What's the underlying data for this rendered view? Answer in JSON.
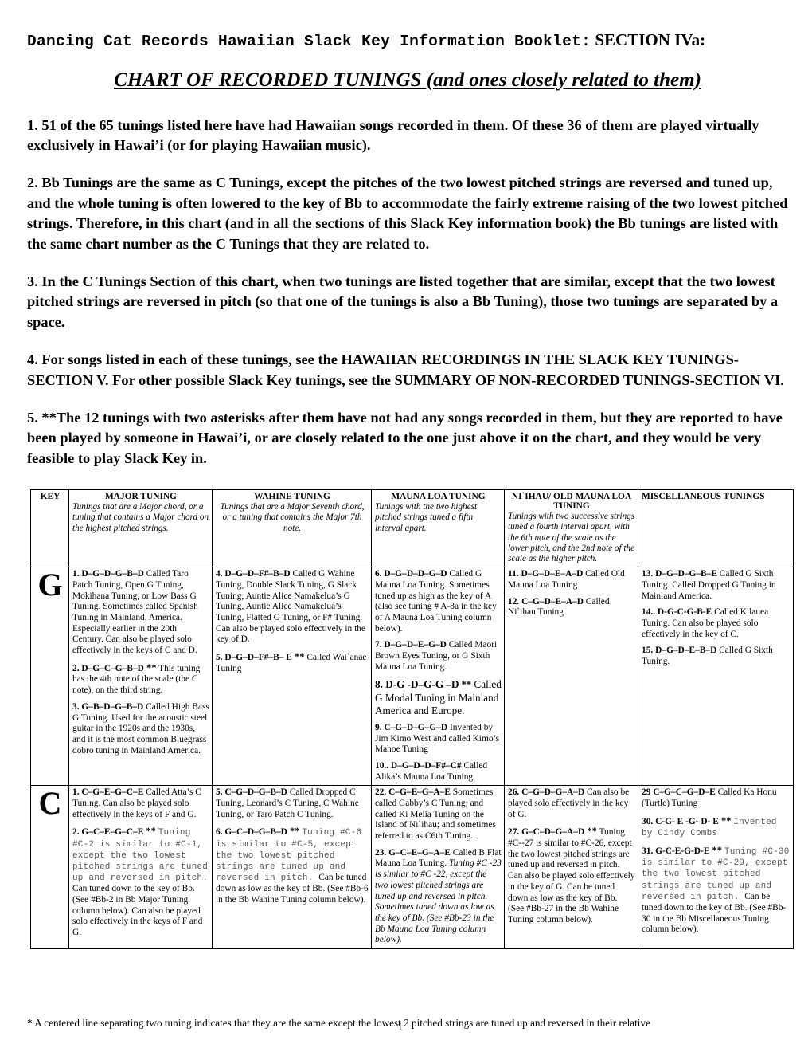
{
  "header": {
    "booklet_title_mono": "Dancing Cat Records Hawaiian Slack Key Information Booklet:",
    "booklet_title_serif": " SECTION IVa:",
    "chart_title_underlined": "CHART OF RECORDED TUNINGS",
    "chart_title_paren": " (and ones closely related to them)"
  },
  "notes": [
    {
      "id": "note-1",
      "text": "1. 51 of the 65 tunings listed here have had Hawaiian songs recorded in them. Of these 36 of them are played virtually exclusively in Hawai’i (or for playing Hawaiian music)."
    },
    {
      "id": "note-2",
      "text": "2. Bb Tunings are the same as C Tunings, except the pitches of the two lowest pitched strings are reversed and tuned up, and the whole tuning is often lowered to the key of Bb to accommodate the fairly extreme raising of the two lowest pitched strings. Therefore, in this chart (and in all the sections of this Slack Key information book) the Bb tunings are listed with the same chart number as the C Tunings that they are related to."
    },
    {
      "id": "note-3",
      "text": "3. In the C Tunings Section of this chart, when two tunings are listed together that are similar, except that the two lowest pitched strings are reversed in pitch (so that one of the tunings is also a Bb Tuning), those two tunings are separated by a space."
    },
    {
      "id": "note-4",
      "text": "4. For songs listed in each of these tunings, see the HAWAIIAN RECORDINGS IN THE SLACK KEY TUNINGS-SECTION V.  For other possible Slack Key tunings, see the SUMMARY OF NON-RECORDED TUNINGS-SECTION VI."
    },
    {
      "id": "note-5",
      "text": "5. **The 12 tunings with two asterisks after them have not had any songs recorded in them, but they are reported to have been played by someone in Hawai’i, or are closely related to the one just above  it on the chart, and they would be very feasible to play Slack Key in."
    }
  ],
  "table": {
    "headers": [
      {
        "title": "KEY",
        "desc": ""
      },
      {
        "title": "MAJOR TUNING",
        "desc": "Tunings that are a Major chord, or a tuning that contains a Major chord on the highest pitched strings."
      },
      {
        "title": "WAHINE TUNING",
        "desc": "Tunings that are a Major Seventh chord, or a tuning that contains the Major 7th note."
      },
      {
        "title": "MAUNA LOA TUNING",
        "desc": "Tunings with the two highest pitched strings tuned a fifth interval apart."
      },
      {
        "title": "NI`IHAU/ OLD MAUNA LOA TUNING",
        "desc": "Tunings with two successive strings tuned a fourth interval apart, with the 6th note of the scale as the lower pitch, and the 2nd note of the scale as the higher pitch."
      },
      {
        "title": "MISCELLANEOUS TUNINGS",
        "desc": ""
      }
    ],
    "rows": [
      {
        "key": "G",
        "major": [
          {
            "num": "1. D–G–D–G–B–D",
            "asterisks": "",
            "body": "Called Taro Patch Tuning, Open G Tuning, Mokihana Tuning, or Low Bass G Tuning. Sometimes called Spanish Tuning in Mainland. America. Especially earlier in the 20th Century. Can also be played solo effectively in the keys of C and D."
          },
          {
            "num": "2.  D–G–C–G–B–D",
            "asterisks": "**",
            "body": "This tuning has the 4th note of the scale (the C note), on the third string."
          },
          {
            "num": "3.  G–B–D–G–B–D",
            "asterisks": "",
            "body": "Called High Bass G Tuning. Used for the acoustic steel guitar in the 1920s and the 1930s, and it is the most common Bluegrass dobro tuning in Mainland America."
          }
        ],
        "wahine": [
          {
            "num": "4. D–G–D–F#–B–D",
            "asterisks": "",
            "body": "Called G Wahine Tuning, Double Slack Tuning, G Slack Tuning, Auntie Alice Namakelua’s G Tuning, Auntie Alice Namakelua’s Tuning, Flatted G Tuning, or F# Tuning. Can also be played solo effectively in the key of  D."
          },
          {
            "num": "5. D–G–D–F#–B– E",
            "asterisks": "**",
            "body": "Called Wai`anae Tuning"
          }
        ],
        "mauna": [
          {
            "num": "6. D–G–D–D–G–D",
            "asterisks": "",
            "body": "Called G Mauna Loa Tuning. Sometimes tuned up as high as the key of A (also see tuning # A-8a  in the key of A Mauna Loa Tuning column below)."
          },
          {
            "num": "7. D–G–D–E–G–D",
            "asterisks": "",
            "body": "Called Maori Brown Eyes Tuning, or G Sixth Mauna Loa Tuning."
          },
          {
            "num": "8. D-G -D–G-G –D",
            "asterisks": "**",
            "body": "Called G Modal Tuning in Mainland America and Europe."
          },
          {
            "num": "9. C–G–D–G–G–D",
            "asterisks": "",
            "body": "Invented by Jim Kimo West and called Kimo’s Mahoe Tuning"
          },
          {
            "num": "10.. D–G–D–D–F#–C#",
            "asterisks": "",
            "body": "Called Alika’s Mauna Loa Tuning"
          }
        ],
        "niihau": [
          {
            "num": "11.  D–G–D–E–A–D",
            "asterisks": "",
            "body": "Called Old Mauna Loa Tuning"
          },
          {
            "num": "12. C–G–D–E–A–D",
            "asterisks": "",
            "body": "Called Ni`ihau Tuning"
          }
        ],
        "misc": [
          {
            "num": "13.  D–G–D–G–B–E",
            "asterisks": "",
            "body": "Called G Sixth Tuning. Called Dropped G Tuning in Mainland America."
          },
          {
            "num": "14.. D-G-C-G-B-E",
            "asterisks": "",
            "body": "Called Kilauea Tuning. Can also be played solo effectively in the key of C."
          },
          {
            "num": "15.  D–G–D–E–B–D",
            "asterisks": "",
            "body": "Called G Sixth Tuning."
          }
        ]
      },
      {
        "key": "C",
        "major": [
          {
            "num": "1. C–G–E–G–C–E",
            "asterisks": "",
            "body": "Called Atta’s C Tuning. Can also be played solo effectively in the keys of F and G."
          },
          {
            "num": "2. G–C–E–G–C–E",
            "asterisks": "**",
            "mono": "Tuning #C-2 is similar to #C-1, except the two lowest pitched strings are tuned up and reversed in pitch.",
            "body": "Can tuned down to the key of Bb.  (See #Bb-2 in Bb Major Tuning column below). Can also be played solo effectively in the keys of F and G."
          }
        ],
        "wahine": [
          {
            "num": "5. C–G–D–G–B–D",
            "asterisks": "",
            "body": "Called Dropped C Tuning, Leonard’s C Tuning, C Wahine Tuning, or Taro Patch C Tuning."
          },
          {
            "num": "6. G–C–D–G–B–D",
            "asterisks": "**",
            "mono": "Tuning #C-6 is similar to #C-5, except the two lowest pitched strings are tuned up and reversed in pitch.",
            "body": "Can be tuned down as low as the key of Bb. (See #Bb-6 in the Bb Wahine Tuning column below)."
          }
        ],
        "mauna": [
          {
            "num": "22. C–G–E–G–A–E",
            "asterisks": "",
            "body": "Sometimes called Gabby’s C Tuning; and called Ki Melia Tuning on the Island of Ni`ihau; and sometimes referred to as C6th Tuning."
          },
          {
            "num": "23. G–C–E–G–A–E",
            "asterisks": "",
            "body": "Called B Flat Mauna Loa Tuning.",
            "italic_tail": "Tuning #C -23 is similar to #C -22, except the two lowest pitched strings are tuned up and reversed in pitch.  Sometimes tuned down as low as the key of Bb. (See #Bb-23 in the Bb Mauna Loa Tuning column below)."
          }
        ],
        "niihau": [
          {
            "num": "26. C–G–D–G–A–D",
            "asterisks": "",
            "body": "Can also be played solo effectively in the key of G."
          },
          {
            "num": "27. G–C–D–G–A–D",
            "asterisks": "**",
            "body": "Tuning #C--27 is similar to #C-26, except the two lowest pitched strings are tuned up and reversed in pitch. Can also be played solo effectively in the key of G. Can be tuned down as low as the key of Bb. (See #Bb-27 in the Bb Wahine Tuning column below)."
          }
        ],
        "misc": [
          {
            "num": "29 C–G–C–G–D–E",
            "asterisks": "",
            "body": "Called Ka Honu (Turtle) Tuning"
          },
          {
            "num": "30. C-G- E -G- D- E",
            "asterisks": "**",
            "mono": "Invented by Cindy Combs"
          },
          {
            "num": "31. G-C-E-G-D-E",
            "asterisks": "**",
            "mono": "Tuning #C-30 is similar to #C-29, except the two lowest pitched strings are tuned up and reversed in pitch.",
            "body": "Can be tuned down to the key of Bb. (See #Bb-30 in the Bb Miscellaneous Tuning column below)."
          }
        ]
      }
    ]
  },
  "footnote": {
    "text": "* A centered line separating two tuning  indicates that they are the same except the lowest 2 pitched strings are tuned up and reversed in their relative",
    "page_number": "1"
  }
}
